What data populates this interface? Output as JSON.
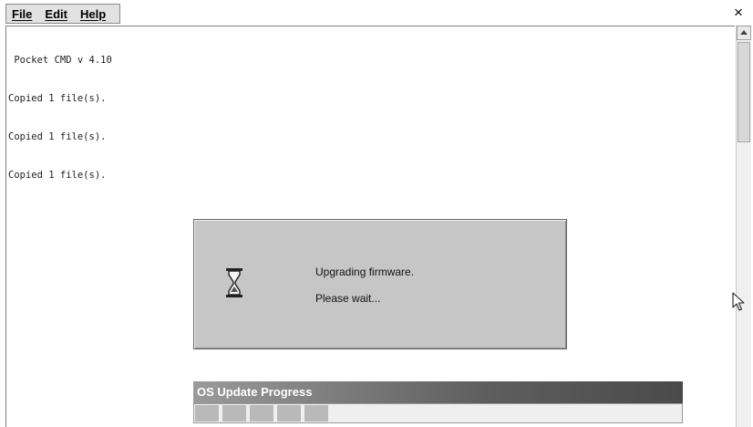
{
  "menu": {
    "file": "File",
    "edit": "Edit",
    "help": "Help",
    "close": "×"
  },
  "console": {
    "lines": [
      " Pocket CMD v 4.10",
      "Copied 1 file(s).",
      "Copied 1 file(s).",
      "Copied 1 file(s)."
    ]
  },
  "dialog": {
    "icon": "hourglass-icon",
    "message": "Upgrading firmware.",
    "wait": "Please wait..."
  },
  "progress": {
    "title": "OS Update Progress",
    "segments_filled": 5,
    "fraction": 0.29
  },
  "colors": {
    "dialog_bg": "#c6c6c6",
    "title_bar": "#5e5e5e",
    "progress_fill": "#b9b9b9"
  }
}
